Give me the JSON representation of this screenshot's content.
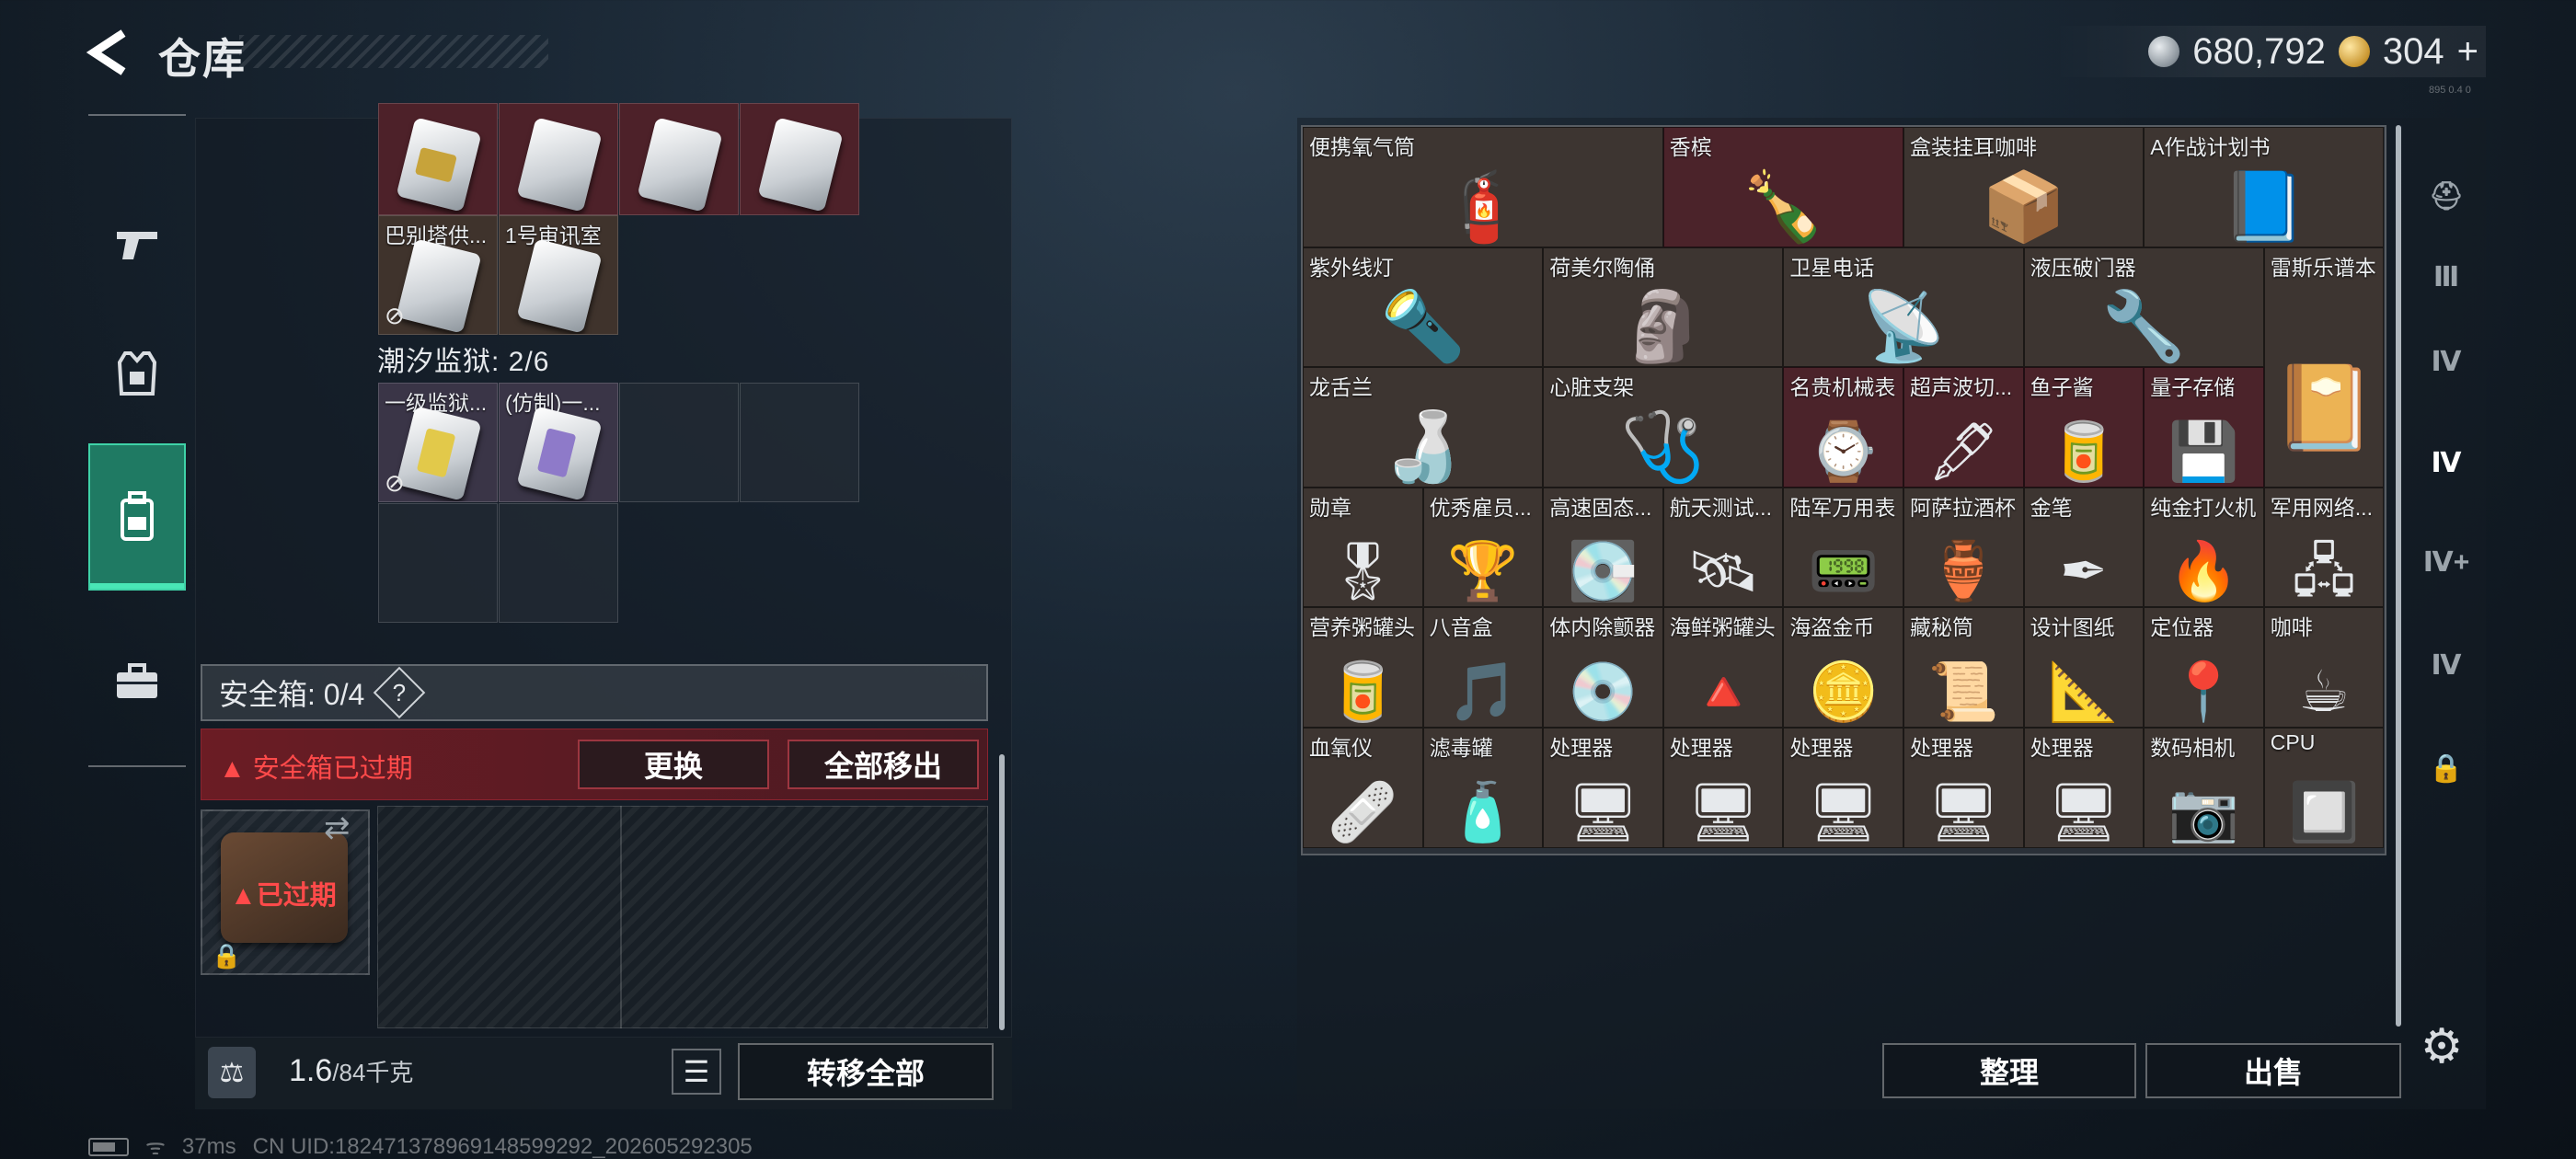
{
  "header": {
    "title": "仓库",
    "currency_silver": "680,792",
    "currency_gold": "304",
    "gold_add": "+",
    "version": "895 0.4 0"
  },
  "left_nav": {
    "items": [
      {
        "name": "weapons",
        "icon": "pistol-icon"
      },
      {
        "name": "armor",
        "icon": "vest-icon"
      },
      {
        "name": "backpack",
        "icon": "backpack-icon",
        "active": true
      },
      {
        "name": "case",
        "icon": "briefcase-icon"
      }
    ]
  },
  "backpack": {
    "keys_row1": [
      {
        "label": "",
        "color": "red",
        "card": "gold"
      },
      {
        "label": "",
        "color": "red",
        "card": "plain"
      },
      {
        "label": "",
        "color": "red",
        "card": "plain"
      },
      {
        "label": "",
        "color": "red",
        "card": "plain"
      }
    ],
    "keys_row2": [
      {
        "label": "巴别塔供...",
        "color": "brown",
        "no_link": true
      },
      {
        "label": "1号审讯室",
        "color": "brown"
      }
    ],
    "section_label": "潮汐监狱: 2/6",
    "prison_keys": [
      {
        "label": "一级监狱...",
        "no_link": true
      },
      {
        "label": "(仿制)一..."
      }
    ],
    "safe_box_label": "安全箱: 0/4",
    "safe_help": "?",
    "safe_expired_warning": "安全箱已过期",
    "replace_button": "更换",
    "remove_all_button": "全部移出",
    "safe_slot_status": "已过期",
    "weight_current": "1.6",
    "weight_max": "/84千克",
    "transfer_all_button": "转移全部"
  },
  "status_bar": {
    "ping": "37ms",
    "uid": "CN UID:1824713789691485992​92_202605292305"
  },
  "warehouse": {
    "rows": [
      [
        {
          "label": "便携氧气筒",
          "span": 3,
          "glyph": "🧯",
          "color": "brown"
        },
        {
          "label": "香槟",
          "span": 2,
          "glyph": "🍾",
          "color": "red"
        },
        {
          "label": "盒装挂耳咖啡",
          "span": 2,
          "glyph": "📦",
          "color": "brown"
        },
        {
          "label": "A作战计划书",
          "span": 2,
          "glyph": "📘",
          "color": "brown"
        }
      ],
      [
        {
          "label": "紫外线灯",
          "span": 2,
          "glyph": "🔦",
          "color": "brown"
        },
        {
          "label": "荷美尔陶俑",
          "span": 2,
          "glyph": "🗿",
          "color": "brown"
        },
        {
          "label": "卫星电话",
          "span": 2,
          "glyph": "📡",
          "color": "brown"
        },
        {
          "label": "液压破门器",
          "span": 2,
          "glyph": "🔧",
          "color": "brown"
        },
        {
          "label": "雷斯乐谱本",
          "span": 1,
          "tall": true,
          "glyph": "📔",
          "color": "brown"
        }
      ],
      [
        {
          "label": "龙舌兰",
          "span": 2,
          "glyph": "🍶",
          "color": "brown"
        },
        {
          "label": "心脏支架",
          "span": 2,
          "glyph": "🩺",
          "color": "brown"
        },
        {
          "label": "名贵机械表",
          "span": 1,
          "glyph": "⌚",
          "color": "red"
        },
        {
          "label": "超声波切...",
          "span": 1,
          "glyph": "🖋",
          "color": "red"
        },
        {
          "label": "鱼子酱",
          "span": 1,
          "glyph": "🥫",
          "color": "red"
        },
        {
          "label": "量子存储",
          "span": 1,
          "glyph": "💾",
          "color": "red"
        }
      ],
      [
        {
          "label": "勋章",
          "span": 1,
          "glyph": "🎖",
          "color": "brown"
        },
        {
          "label": "优秀雇员...",
          "span": 1,
          "glyph": "🏆",
          "color": "brown"
        },
        {
          "label": "高速固态...",
          "span": 1,
          "glyph": "💽",
          "color": "brown"
        },
        {
          "label": "航天测试...",
          "span": 1,
          "glyph": "🛰",
          "color": "brown"
        },
        {
          "label": "陆军万用表",
          "span": 1,
          "glyph": "📟",
          "color": "brown"
        },
        {
          "label": "阿萨拉酒杯",
          "span": 1,
          "glyph": "🏺",
          "color": "brown"
        },
        {
          "label": "金笔",
          "span": 1,
          "glyph": "✒",
          "color": "brown"
        },
        {
          "label": "纯金打火机",
          "span": 1,
          "glyph": "🔥",
          "color": "brown"
        },
        {
          "label": "军用网络...",
          "span": 1,
          "glyph": "🖧",
          "color": "brown"
        }
      ],
      [
        {
          "label": "营养粥罐头",
          "span": 1,
          "glyph": "🥫",
          "color": "brown"
        },
        {
          "label": "八音盒",
          "span": 1,
          "glyph": "🎵",
          "color": "brown"
        },
        {
          "label": "体内除颤器",
          "span": 1,
          "glyph": "💿",
          "color": "brown"
        },
        {
          "label": "海鲜粥罐头",
          "span": 1,
          "glyph": "🔺",
          "color": "brown"
        },
        {
          "label": "海盗金币",
          "span": 1,
          "glyph": "🪙",
          "color": "brown"
        },
        {
          "label": "藏秘筒",
          "span": 1,
          "glyph": "📜",
          "color": "brown"
        },
        {
          "label": "设计图纸",
          "span": 1,
          "glyph": "📐",
          "color": "brown"
        },
        {
          "label": "定位器",
          "span": 1,
          "glyph": "📍",
          "color": "brown"
        },
        {
          "label": "咖啡",
          "span": 1,
          "glyph": "☕",
          "color": "brown"
        }
      ],
      [
        {
          "label": "血氧仪",
          "span": 1,
          "glyph": "🩹",
          "color": "brown"
        },
        {
          "label": "滤毒罐",
          "span": 1,
          "glyph": "🧴",
          "color": "brown"
        },
        {
          "label": "处理器",
          "span": 1,
          "glyph": "🖥",
          "color": "brown"
        },
        {
          "label": "处理器",
          "span": 1,
          "glyph": "🖥",
          "color": "brown"
        },
        {
          "label": "处理器",
          "span": 1,
          "glyph": "🖥",
          "color": "brown"
        },
        {
          "label": "处理器",
          "span": 1,
          "glyph": "🖥",
          "color": "brown"
        },
        {
          "label": "处理器",
          "span": 1,
          "glyph": "🖥",
          "color": "brown"
        },
        {
          "label": "数码相机",
          "span": 1,
          "glyph": "📷",
          "color": "brown"
        },
        {
          "label": "CPU",
          "span": 1,
          "glyph": "🔲",
          "color": "brown"
        }
      ]
    ],
    "sort_button": "整理",
    "sell_button": "出售"
  },
  "right_rail": {
    "items": [
      {
        "name": "helmet-tab",
        "text": "⛑"
      },
      {
        "name": "tier3-tab",
        "text": "Ⅲ"
      },
      {
        "name": "tier4-gun-tab",
        "text": "Ⅳ"
      },
      {
        "name": "tier4-box-tab",
        "text": "Ⅳ",
        "active": true
      },
      {
        "name": "tier4-medkit-tab",
        "text": "Ⅳ+"
      },
      {
        "name": "tier4-key-tab",
        "text": "Ⅳ"
      },
      {
        "name": "locked-tab",
        "text": "🔒"
      }
    ]
  },
  "colors": {
    "accent_green": "#1f7a63",
    "cell_red": "#4b232a",
    "cell_brown": "#3d3531",
    "warning_red": "#ff4a4a"
  }
}
